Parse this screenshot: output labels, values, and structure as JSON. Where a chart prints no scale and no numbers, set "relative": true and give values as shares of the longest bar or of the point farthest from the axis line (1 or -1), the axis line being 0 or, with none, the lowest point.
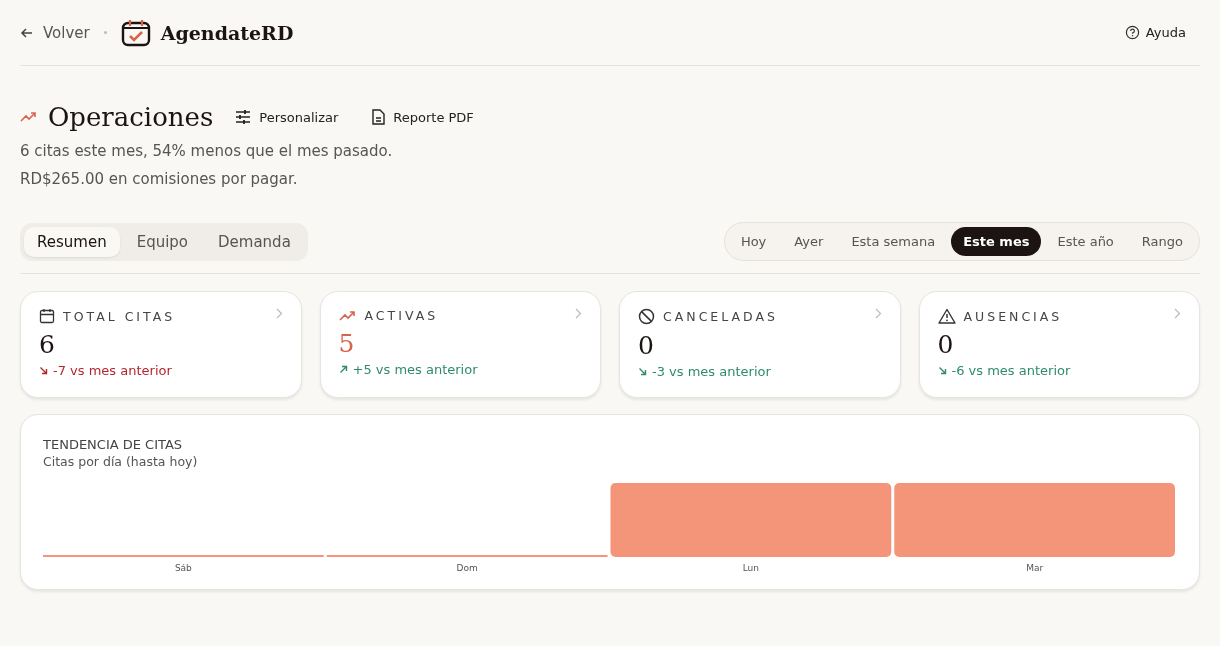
{
  "header": {
    "back": "Volver",
    "brand": "AgendateRD",
    "help": "Ayuda"
  },
  "page": {
    "title": "Operaciones",
    "actions": [
      {
        "kind": "sliders",
        "label": "Personalizar"
      },
      {
        "kind": "document",
        "label": "Reporte PDF"
      }
    ],
    "summary": [
      "6 citas este mes, 54% menos que el mes pasado.",
      "RD$265.00 en comisiones por pagar."
    ]
  },
  "tabs": [
    {
      "label": "Resumen",
      "selected": true
    },
    {
      "label": "Equipo",
      "selected": false
    },
    {
      "label": "Demanda",
      "selected": false
    }
  ],
  "periods": [
    {
      "label": "Hoy",
      "selected": false
    },
    {
      "label": "Ayer",
      "selected": false
    },
    {
      "label": "Esta semana",
      "selected": false
    },
    {
      "label": "Este mes",
      "selected": true
    },
    {
      "label": "Este año",
      "selected": false
    },
    {
      "label": "Rango",
      "selected": false
    }
  ],
  "metrics": [
    {
      "kind": "calendar",
      "label": "TOTAL CITAS",
      "value": "6",
      "accent": false,
      "rising": false,
      "favorable": false,
      "change": "-7 vs mes anterior"
    },
    {
      "kind": "trend",
      "label": "ACTIVAS",
      "value": "5",
      "accent": true,
      "rising": true,
      "favorable": true,
      "change": "+5 vs mes anterior"
    },
    {
      "kind": "ban",
      "label": "CANCELADAS",
      "value": "0",
      "accent": false,
      "rising": false,
      "favorable": true,
      "change": "-3 vs mes anterior"
    },
    {
      "kind": "warning",
      "label": "AUSENCIAS",
      "value": "0",
      "accent": false,
      "rising": false,
      "favorable": true,
      "change": "-6 vs mes anterior"
    }
  ],
  "trend_card": {
    "title": "TENDENCIA DE CITAS",
    "subtitle": "Citas por día (hasta hoy)",
    "chart_data": {
      "type": "bar",
      "relative": true,
      "categories": [
        "Sáb",
        "Dom",
        "Lun",
        "Mar"
      ],
      "series": [
        {
          "color": "#f4957a",
          "values": [
            0,
            0,
            1,
            1
          ]
        }
      ]
    }
  }
}
